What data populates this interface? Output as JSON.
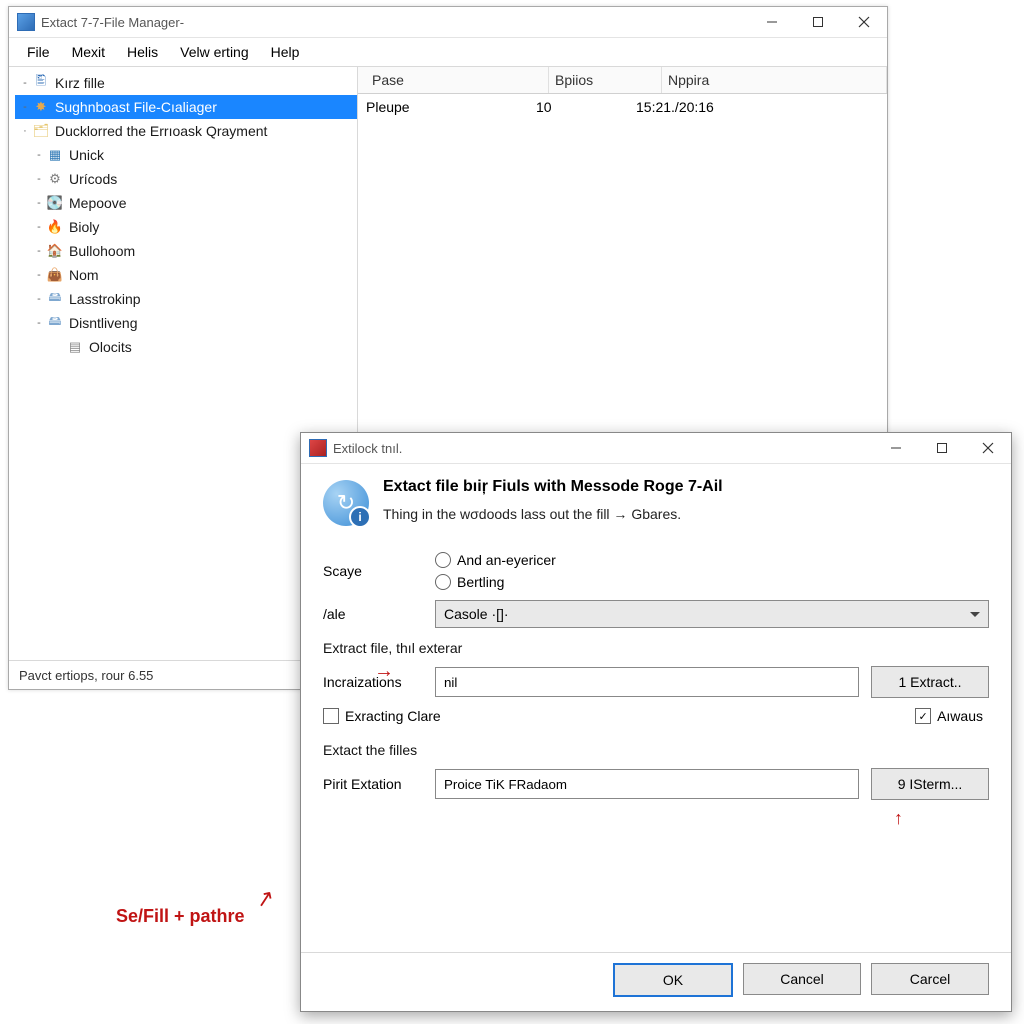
{
  "main_window": {
    "title": "Extact 7-7-File Manager-",
    "menubar": [
      "File",
      "Mexit",
      "Helis",
      "Velw erting",
      "Help"
    ],
    "tree": [
      {
        "depth": 0,
        "exp": "-",
        "icon": "file-icon",
        "iconClass": "ico-file",
        "label": "Kırz fille",
        "selected": false
      },
      {
        "depth": 0,
        "exp": "-",
        "icon": "star-icon",
        "iconClass": "ico-star",
        "label": "Sughnboast File-Cıaliager",
        "selected": true
      },
      {
        "depth": 0,
        "exp": "·",
        "icon": "folder-icon",
        "iconClass": "ico-folder",
        "label": "Ducklorred the Errıoask Qrayment",
        "selected": false
      },
      {
        "depth": 1,
        "exp": "-",
        "icon": "chip-icon",
        "iconClass": "ico-chip",
        "label": "Unick",
        "selected": false
      },
      {
        "depth": 1,
        "exp": "-",
        "icon": "gear-icon",
        "iconClass": "ico-gear",
        "label": "Urícods",
        "selected": false
      },
      {
        "depth": 1,
        "exp": "-",
        "icon": "disk-icon",
        "iconClass": "ico-disk",
        "label": "Mepoove",
        "selected": false
      },
      {
        "depth": 1,
        "exp": "-",
        "icon": "flame-icon",
        "iconClass": "ico-flame",
        "label": "Bioly",
        "selected": false
      },
      {
        "depth": 1,
        "exp": "-",
        "icon": "box-icon",
        "iconClass": "ico-box",
        "label": "Bullohoom",
        "selected": false
      },
      {
        "depth": 1,
        "exp": "-",
        "icon": "bag-icon",
        "iconClass": "ico-bag",
        "label": "Nom",
        "selected": false
      },
      {
        "depth": 1,
        "exp": "-",
        "icon": "drive-icon",
        "iconClass": "ico-drive",
        "label": "Lasstrokinp",
        "selected": false
      },
      {
        "depth": 1,
        "exp": "-",
        "icon": "drive-icon",
        "iconClass": "ico-drive",
        "label": "Disntliveng",
        "selected": false
      },
      {
        "depth": 2,
        "exp": "",
        "icon": "grey-icon",
        "iconClass": "ico-grey",
        "label": "Olocits",
        "selected": false
      }
    ],
    "list": {
      "columns": [
        "Pase",
        "Bpiios",
        "Nppira"
      ],
      "rows": [
        [
          "Pleupe",
          "10",
          "15:21./20:16"
        ]
      ]
    },
    "status": "Pavct ertiops, rour 6.55"
  },
  "dialog": {
    "title": "Extilock tnıl.",
    "heading": "Extact file bıiŗ Fiuls with Messode Roge 7-Ail",
    "subheading": "Thing in the wσdoods lass out the fill → Gbares.",
    "scope_label": "Scaye",
    "scope_options": [
      "And an-eyericer",
      "Bertling"
    ],
    "sale_label": "/ale",
    "sale_value": "Casole ·[]·",
    "section1_label": "Extract file, thıl exterar",
    "incraizations_label": "Incraizations",
    "incraizations_value": "nil",
    "extract_btn": "1 Extract..",
    "extracting_clare_label": "Exracting Clare",
    "extracting_clare_checked": false,
    "always_label": "Aıwaus",
    "always_checked": true,
    "section2_label": "Extact the filles",
    "dest_label": "Pirit Extation",
    "dest_value": "Proice TiK FRadaom",
    "isterm_btn": "9 ISterm...",
    "footer": {
      "ok": "OK",
      "cancel1": "Cancel",
      "cancel2": "Carcel"
    }
  },
  "annotation": "Se/Fill + pathre",
  "icon_glyphs": {
    "file-icon": "🖺",
    "star-icon": "✸",
    "folder-icon": "🗂",
    "chip-icon": "▦",
    "gear-icon": "⚙",
    "disk-icon": "💽",
    "flame-icon": "🔥",
    "box-icon": "🏠",
    "bag-icon": "👜",
    "drive-icon": "🖴",
    "grey-icon": "▤"
  }
}
